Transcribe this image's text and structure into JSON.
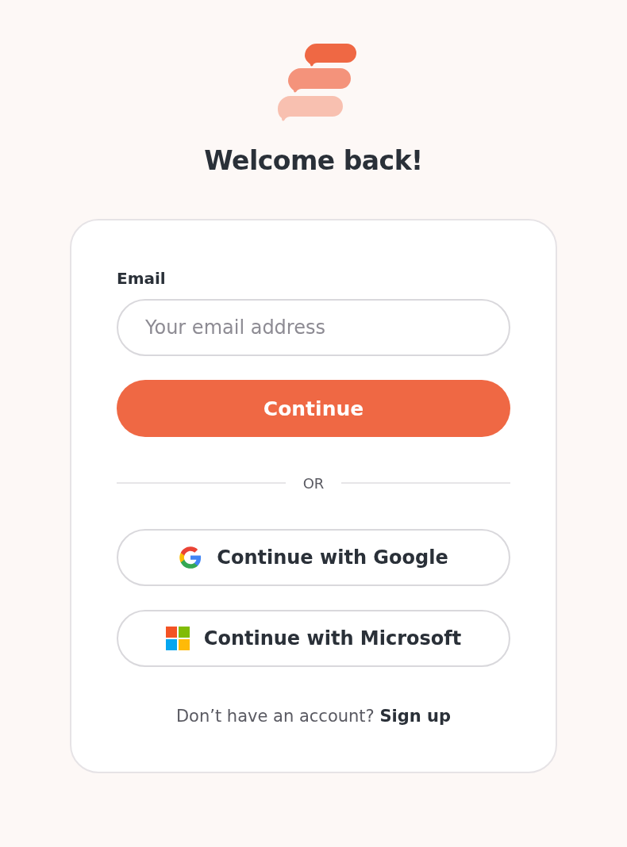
{
  "title": "Welcome back!",
  "form": {
    "email_label": "Email",
    "email_placeholder": "Your email address",
    "submit": "Continue"
  },
  "divider": "OR",
  "providers": [
    {
      "kind": "google",
      "label": "Continue with Google"
    },
    {
      "kind": "microsoft",
      "label": "Continue with Microsoft"
    }
  ],
  "signup": {
    "prompt": "Don’t have an account?",
    "link": "Sign up"
  }
}
